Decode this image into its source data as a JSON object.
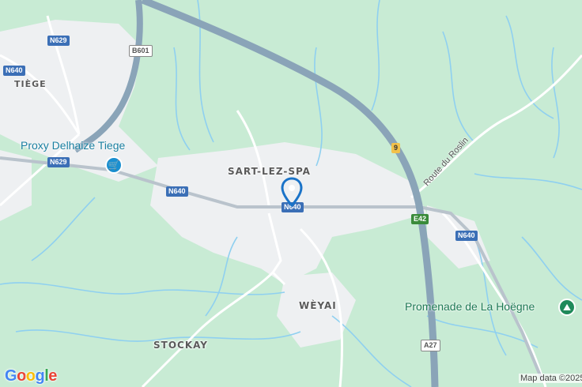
{
  "map": {
    "places": {
      "tiege": "TIÈGE",
      "sart": "SART-LEZ-SPA",
      "weyai": "WÈYAI",
      "stockay": "STOCKAY"
    },
    "pois": {
      "delhaize": "Proxy Delhaize Tiege",
      "hoegne": "Promenade de La Hoëgne"
    },
    "shields": {
      "n629_top": "N629",
      "n640_left": "N640",
      "b601": "B601",
      "n629_mid": "N629",
      "n640_mid": "N640",
      "n640_center": "N640",
      "route_9": "9",
      "e42": "E42",
      "n640_right": "N640",
      "a27": "A27"
    },
    "road_names": {
      "roslin": "Route du Roslin"
    },
    "google_logo": "Google",
    "attribution": "Map data ©2025",
    "colors": {
      "land": "#c8ebd4",
      "urban": "#eef0f2",
      "highway": "#8aa4b8",
      "water": "#8fd0f0",
      "pin": "#1a73c8"
    },
    "icons": {
      "pin": "map-pin-icon",
      "cart": "shopping-cart-icon",
      "hiker": "hiking-icon"
    }
  }
}
